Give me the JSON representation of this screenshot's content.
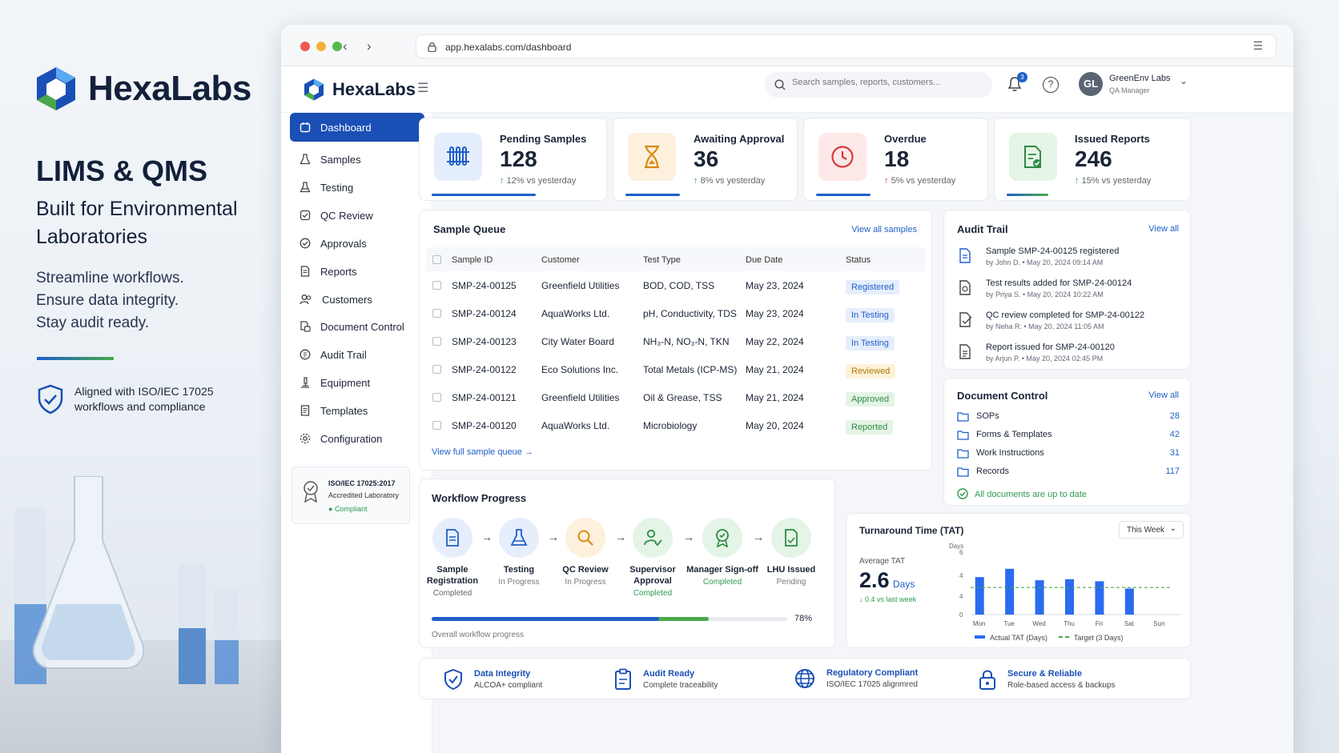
{
  "brand": {
    "name": "HexaLabs",
    "accent": "#1a4fb5",
    "green": "#4aa84a"
  },
  "hero": {
    "title": "LIMS & QMS",
    "subtitle": "Built for Environmental Laboratories",
    "taglines": [
      "Streamline workflows.",
      "Ensure data integrity.",
      "Stay audit ready."
    ],
    "iso_note": "Aligned with ISO/IEC 17025 workflows and compliance"
  },
  "browser": {
    "url": "app.hexalabs.com/dashboard"
  },
  "header": {
    "search_placeholder": "Search samples, reports, customers...",
    "notif_count": "3",
    "user_initials": "GL",
    "user_name": "GreenEnv Labs",
    "user_role": "QA Manager"
  },
  "sidebar": {
    "items": [
      {
        "label": "Dashboard",
        "icon": "dashboard-icon"
      },
      {
        "label": "Samples",
        "icon": "flask-icon"
      },
      {
        "label": "Testing",
        "icon": "beaker-icon"
      },
      {
        "label": "QC Review",
        "icon": "shield-check-icon"
      },
      {
        "label": "Approvals",
        "icon": "check-circle-icon"
      },
      {
        "label": "Reports",
        "icon": "document-icon"
      },
      {
        "label": "Customers",
        "icon": "users-icon"
      },
      {
        "label": "Document Control",
        "icon": "documents-icon"
      },
      {
        "label": "Audit Trail",
        "icon": "audit-icon"
      },
      {
        "label": "Equipment",
        "icon": "microscope-icon"
      },
      {
        "label": "Templates",
        "icon": "template-icon"
      },
      {
        "label": "Configuration",
        "icon": "gear-icon"
      }
    ],
    "accreditation": {
      "title": "ISO/IEC 17025:2017",
      "sub": "Accredited Laboratory",
      "status": "Compliant"
    }
  },
  "kpis": [
    {
      "label": "Pending Samples",
      "value": "128",
      "change": "12% vs yesterday",
      "dir": "↑",
      "dir_color": "#2e9b4e",
      "progress": 0.68,
      "icon": "rack-icon"
    },
    {
      "label": "Awaiting Approval",
      "value": "36",
      "change": "8% vs yesterday",
      "dir": "↑",
      "dir_color": "#2e9b4e",
      "progress": 0.32,
      "icon": "hourglass-icon"
    },
    {
      "label": "Overdue",
      "value": "18",
      "change": "5% vs yesterday",
      "dir": "↑",
      "dir_color": "#d93a3a",
      "progress": 0.32,
      "icon": "clock-icon"
    },
    {
      "label": "Issued Reports",
      "value": "246",
      "change": "15% vs yesterday",
      "dir": "↑",
      "dir_color": "#2e9b4e",
      "progress": 0.22,
      "icon": "report-check-icon"
    }
  ],
  "queue": {
    "title": "Sample Queue",
    "view_all": "View all samples",
    "columns": [
      "Sample ID",
      "Customer",
      "Test Type",
      "Due Date",
      "Status"
    ],
    "rows": [
      {
        "id": "SMP-24-00125",
        "customer": "Greenfield Utilities",
        "test": "BOD, COD, TSS",
        "due": "May 23, 2024",
        "status": "Registered",
        "bg": "#e6eefc",
        "fg": "#1f5fc9"
      },
      {
        "id": "SMP-24-00124",
        "customer": "AquaWorks Ltd.",
        "test": "pH, Conductivity, TDS",
        "due": "May 23, 2024",
        "status": "In Testing",
        "bg": "#e6eefc",
        "fg": "#1f5fc9"
      },
      {
        "id": "SMP-24-00123",
        "customer": "City Water Board",
        "test": "NH₃-N, NO₃-N, TKN",
        "due": "May 22, 2024",
        "status": "In Testing",
        "bg": "#e6eefc",
        "fg": "#1f5fc9"
      },
      {
        "id": "SMP-24-00122",
        "customer": "Eco Solutions Inc.",
        "test": "Total Metals (ICP-MS)",
        "due": "May 21, 2024",
        "status": "Reviewed",
        "bg": "#fdf2d8",
        "fg": "#b07a0c"
      },
      {
        "id": "SMP-24-00121",
        "customer": "Greenfield Utilities",
        "test": "Oil & Grease, TSS",
        "due": "May 21, 2024",
        "status": "Approved",
        "bg": "#e4f4e6",
        "fg": "#2e8b45"
      },
      {
        "id": "SMP-24-00120",
        "customer": "AquaWorks Ltd.",
        "test": "Microbiology",
        "due": "May 20, 2024",
        "status": "Reported",
        "bg": "#e4f4e6",
        "fg": "#2e8b45"
      }
    ],
    "footer_link": "View full sample queue →"
  },
  "audit": {
    "title": "Audit Trail",
    "view_all": "View all",
    "items": [
      {
        "text": "Sample SMP-24-00125 registered",
        "meta": "by John D.  •  May 20, 2024 09:14 AM"
      },
      {
        "text": "Test results added for SMP-24-00124",
        "meta": "by Priya S.  •  May 20, 2024 10:22 AM"
      },
      {
        "text": "QC review completed for SMP-24-00122",
        "meta": "by Neha R.  •  May 20, 2024 11:05 AM"
      },
      {
        "text": "Report issued for SMP-24-00120",
        "meta": "by Arjun P.  •  May 20, 2024 02:45 PM"
      }
    ]
  },
  "docs": {
    "title": "Document Control",
    "view_all": "View all",
    "items": [
      {
        "label": "SOPs",
        "count": "28"
      },
      {
        "label": "Forms & Templates",
        "count": "42"
      },
      {
        "label": "Work Instructions",
        "count": "31"
      },
      {
        "label": "Records",
        "count": "117"
      }
    ],
    "status": "All documents are up to date"
  },
  "workflow": {
    "title": "Workflow Progress",
    "steps": [
      {
        "name": "Sample Registration",
        "status": "Completed",
        "bg": "#e6eefc",
        "fg": "#1f5fc9",
        "sc": "#666"
      },
      {
        "name": "Testing",
        "status": "In Progress",
        "bg": "#e6eefc",
        "fg": "#1f5fc9",
        "sc": "#888"
      },
      {
        "name": "QC Review",
        "status": "In Progress",
        "bg": "#fdf0dc",
        "fg": "#d98a12",
        "sc": "#888"
      },
      {
        "name": "Supervisor Approval",
        "status": "Completed",
        "bg": "#e4f4e6",
        "fg": "#2e8b45",
        "sc": "#2e9b4e"
      },
      {
        "name": "Manager Sign-off",
        "status": "Completed",
        "bg": "#e4f4e6",
        "fg": "#2e8b45",
        "sc": "#2e9b4e"
      },
      {
        "name": "LHU Issued",
        "status": "Pending",
        "bg": "#e4f4e6",
        "fg": "#2e8b45",
        "sc": "#888"
      }
    ],
    "progress": 0.78,
    "progress_label": "78%",
    "caption": "Overall workflow progress"
  },
  "chart_data": {
    "type": "bar",
    "title": "Turnaround Time (TAT)",
    "period": "This Week",
    "summary_label": "Average TAT",
    "summary_value": "2.6",
    "summary_unit": "Days",
    "summary_change": "↓ 0.4 vs last week",
    "ylabel": "Days",
    "ytick_labels": [
      "6",
      "4",
      "4",
      "0"
    ],
    "categories": [
      "Mon",
      "Tue",
      "Wed",
      "Thu",
      "Fri",
      "Sat",
      "Sun"
    ],
    "values": [
      3.6,
      4.4,
      3.3,
      3.4,
      3.2,
      2.5,
      0
    ],
    "ylim": [
      0,
      6
    ],
    "target": 2.6,
    "series": [
      {
        "name": "Actual TAT (Days)",
        "color": "#2a6bf0"
      }
    ],
    "target_name": "Target (3 Days)",
    "target_color": "#4aa84a"
  },
  "footer": [
    {
      "title": "Data Integrity",
      "sub": "ALCOA+ compliant",
      "icon": "shield-check-icon"
    },
    {
      "title": "Audit Ready",
      "sub": "Complete traceability",
      "icon": "clipboard-icon"
    },
    {
      "title": "Regulatory Compliant",
      "sub": "ISO/IEC 17025 alignmred",
      "icon": "globe-icon"
    },
    {
      "title": "Secure & Reliable",
      "sub": "Role-based access & backups",
      "icon": "lock-icon"
    }
  ]
}
